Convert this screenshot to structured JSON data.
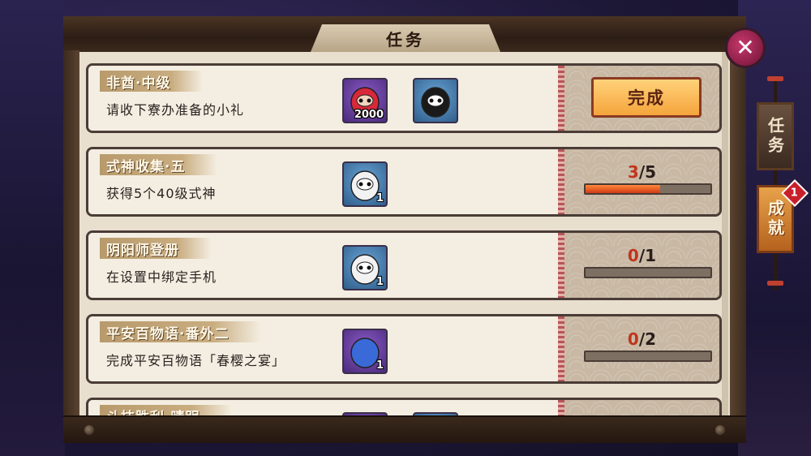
{
  "window": {
    "title": "任务"
  },
  "close_label": "✕",
  "tabs": [
    {
      "label": "任务",
      "active": false
    },
    {
      "label": "成就",
      "active": true,
      "badge": "1"
    }
  ],
  "complete_button_label": "完成",
  "quests": [
    {
      "tag": "非酋·中级",
      "desc": "请收下寮办准备的小礼",
      "rewards": [
        {
          "icon": "red-daruma-icon",
          "count": "2000",
          "bg": "purple"
        },
        {
          "icon": "black-daruma-icon",
          "count": "",
          "bg": "blue"
        }
      ],
      "status": "complete"
    },
    {
      "tag": "式神收集·五",
      "desc": "获得5个40级式神",
      "rewards": [
        {
          "icon": "white-daruma-icon",
          "count": "1",
          "bg": "blue"
        }
      ],
      "status": "progress",
      "progress": {
        "current": "3",
        "total": "/5",
        "fraction": 0.6
      }
    },
    {
      "tag": "阴阳师登册",
      "desc": "在设置中绑定手机",
      "rewards": [
        {
          "icon": "white-daruma-icon",
          "count": "1",
          "bg": "blue"
        }
      ],
      "status": "progress",
      "progress": {
        "current": "0",
        "total": "/1",
        "fraction": 0
      }
    },
    {
      "tag": "平安百物语·番外二",
      "desc": "完成平安百物语「春樱之宴」",
      "rewards": [
        {
          "icon": "scroll-ticket-icon",
          "count": "1",
          "bg": "purple"
        }
      ],
      "status": "progress",
      "progress": {
        "current": "0",
        "total": "/2",
        "fraction": 0
      }
    },
    {
      "tag": "斗技胜利·晴明",
      "desc": "",
      "rewards": [
        {
          "icon": "purple-item-icon",
          "count": "",
          "bg": "purple"
        },
        {
          "icon": "gold-item-icon",
          "count": "",
          "bg": "blue"
        }
      ],
      "status": "progress",
      "progress": {
        "current": "",
        "total": "",
        "fraction": 0
      }
    }
  ],
  "colors": {
    "accent": "#f5a43c",
    "progress_fill": "#d03a16",
    "badge": "#c8202a"
  }
}
